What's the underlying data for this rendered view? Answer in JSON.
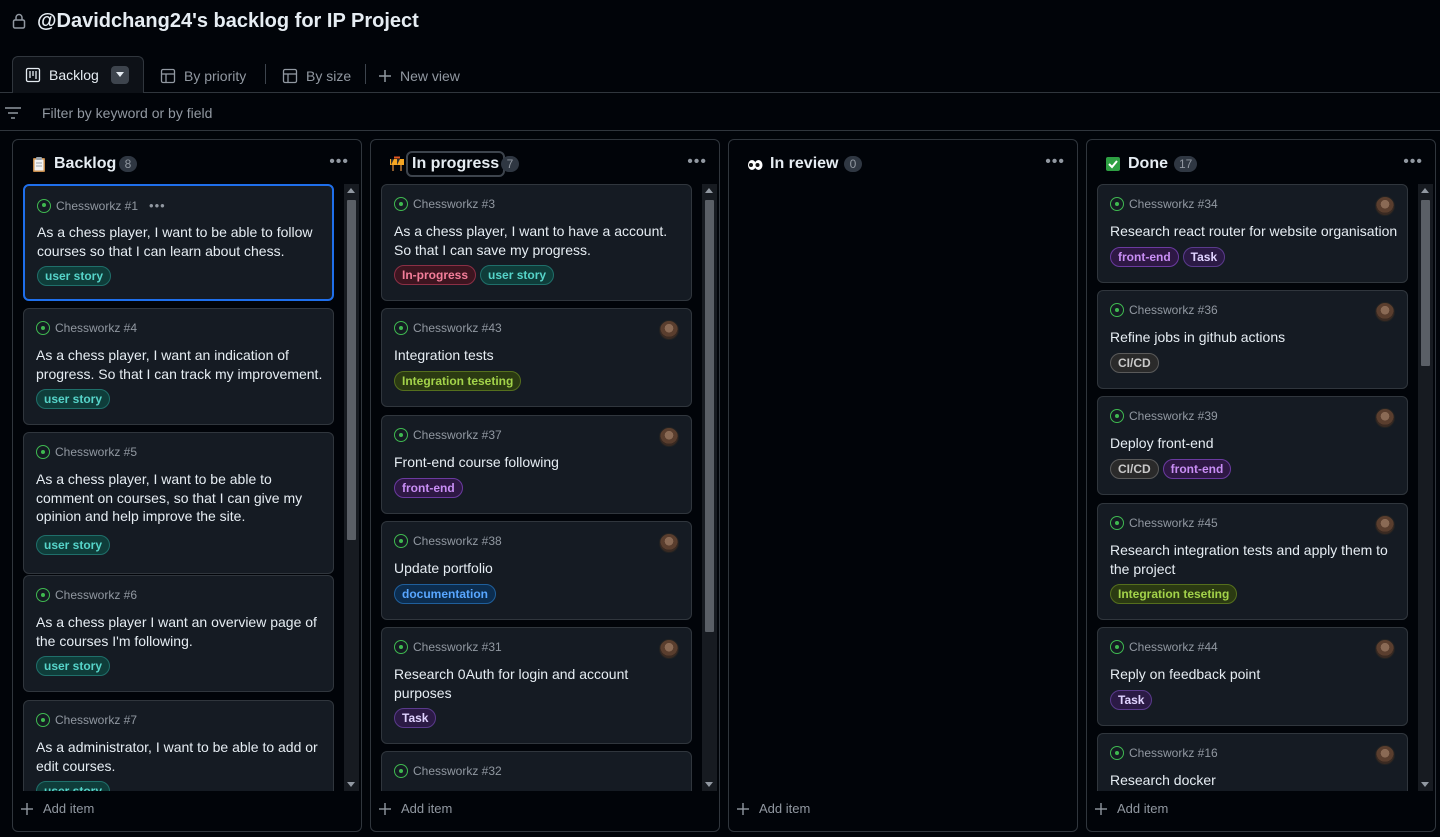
{
  "header": {
    "title": "@Davidchang24's backlog for IP Project"
  },
  "tabs": [
    {
      "label": "Backlog"
    },
    {
      "label": "By priority"
    },
    {
      "label": "By size"
    },
    {
      "label": "New view"
    }
  ],
  "filter": {
    "placeholder": "Filter by keyword or by field"
  },
  "labels_style": {
    "user story": {
      "bg": "#0f3d3a",
      "border": "#1f6f6a",
      "fg": "#56d4c9"
    },
    "In-progress": {
      "bg": "#3d1520",
      "border": "#8b2f45",
      "fg": "#f47e9a"
    },
    "Integration teseting": {
      "bg": "#2b3a12",
      "border": "#556f1d",
      "fg": "#a3d34a"
    },
    "front-end": {
      "bg": "#2e1844",
      "border": "#6b3aa0",
      "fg": "#c98ef5"
    },
    "documentation": {
      "bg": "#0c2d4f",
      "border": "#1f5f9c",
      "fg": "#58a6ff"
    },
    "Task": {
      "bg": "#2b1a45",
      "border": "#5a3a8c",
      "fg": "#e0d3ff"
    },
    "CI/CD": {
      "bg": "#2a2a2a",
      "border": "#5a5a5a",
      "fg": "#c9c9c9"
    }
  },
  "columns": [
    {
      "title": "Backlog",
      "count": "8",
      "emoji": "clipboard-icon",
      "add_label": "Add item",
      "cards": [
        {
          "ref": "Chessworkz #1",
          "title": "As a chess player, I want to be able to follow courses so that I can learn about chess.",
          "labels": [
            "user story"
          ],
          "avatar": false
        },
        {
          "ref": "Chessworkz #4",
          "title": "As a chess player, I want an indication of progress. So that I can track my improvement.",
          "labels": [
            "user story"
          ],
          "avatar": false
        },
        {
          "ref": "Chessworkz #5",
          "title": "As a chess player, I want to be able to comment on courses, so that I can give my opinion and help improve the site.",
          "labels": [
            "user story"
          ],
          "avatar": false
        },
        {
          "ref": "Chessworkz #6",
          "title": "As a chess player I want an overview page of the courses I'm following.",
          "labels": [
            "user story"
          ],
          "avatar": false
        },
        {
          "ref": "Chessworkz #7",
          "title": "As a administrator, I want to be able to add or edit courses.",
          "labels": [
            "user story"
          ],
          "avatar": false
        }
      ]
    },
    {
      "title": "In progress",
      "count": "7",
      "emoji": "construction-icon",
      "add_label": "Add item",
      "cards": [
        {
          "ref": "Chessworkz #3",
          "title": "As a chess player, I want to have a account. So that I can save my progress.",
          "labels": [
            "In-progress",
            "user story"
          ],
          "avatar": false
        },
        {
          "ref": "Chessworkz #43",
          "title": "Integration tests",
          "labels": [
            "Integration teseting"
          ],
          "avatar": true
        },
        {
          "ref": "Chessworkz #37",
          "title": "Front-end course following",
          "labels": [
            "front-end"
          ],
          "avatar": true
        },
        {
          "ref": "Chessworkz #38",
          "title": "Update portfolio",
          "labels": [
            "documentation"
          ],
          "avatar": true
        },
        {
          "ref": "Chessworkz #31",
          "title": "Research 0Auth for login and account purposes",
          "labels": [
            "Task"
          ],
          "avatar": true
        },
        {
          "ref": "Chessworkz #32",
          "title": "",
          "labels": [],
          "avatar": false
        }
      ]
    },
    {
      "title": "In review",
      "count": "0",
      "emoji": "eyes-icon",
      "add_label": "Add item",
      "cards": []
    },
    {
      "title": "Done",
      "count": "17",
      "emoji": "check-icon",
      "add_label": "Add item",
      "cards": [
        {
          "ref": "Chessworkz #34",
          "title": "Research react router for website organisation",
          "labels": [
            "front-end",
            "Task"
          ],
          "avatar": true
        },
        {
          "ref": "Chessworkz #36",
          "title": "Refine jobs in github actions",
          "labels": [
            "CI/CD"
          ],
          "avatar": true
        },
        {
          "ref": "Chessworkz #39",
          "title": "Deploy front-end",
          "labels": [
            "CI/CD",
            "front-end"
          ],
          "avatar": true
        },
        {
          "ref": "Chessworkz #45",
          "title": "Research integration tests and apply them to the project",
          "labels": [
            "Integration teseting"
          ],
          "avatar": true
        },
        {
          "ref": "Chessworkz #44",
          "title": "Reply on feedback point",
          "labels": [
            "Task"
          ],
          "avatar": true
        },
        {
          "ref": "Chessworkz #16",
          "title": "Research docker",
          "labels": [],
          "avatar": true
        }
      ]
    }
  ]
}
